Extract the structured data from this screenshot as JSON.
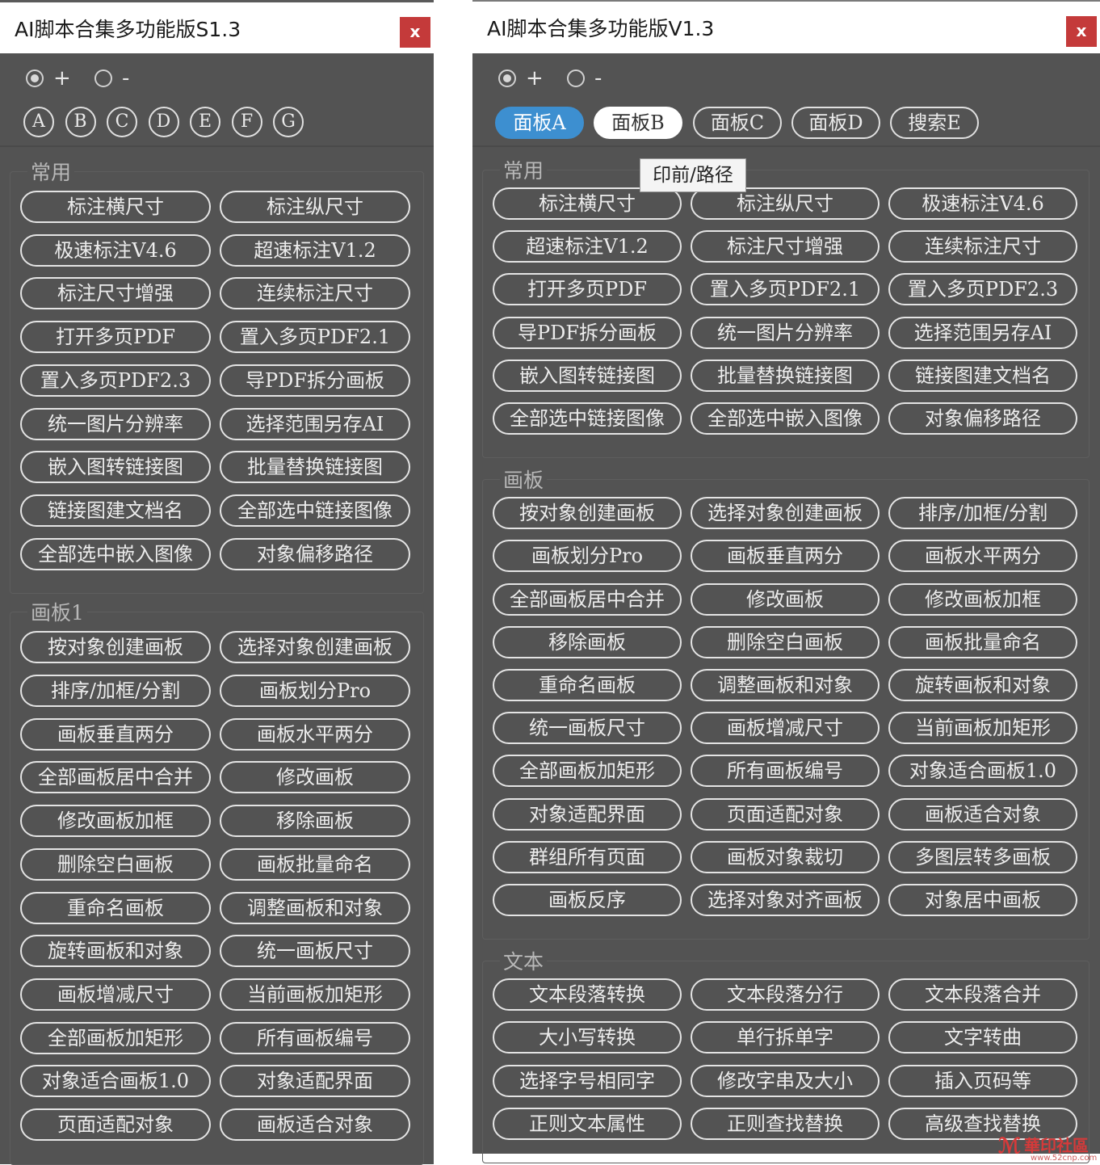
{
  "left_window": {
    "title": "AI脚本合集多功能版S1.3",
    "close_label": "x",
    "radio_plus": "+",
    "radio_minus": "-",
    "tabs": [
      "A",
      "B",
      "C",
      "D",
      "E",
      "F",
      "G"
    ],
    "groups": [
      {
        "label": "常用",
        "buttons": [
          "标注横尺寸",
          "标注纵尺寸",
          "极速标注V4.6",
          "超速标注V1.2",
          "标注尺寸增强",
          "连续标注尺寸",
          "打开多页PDF",
          "置入多页PDF2.1",
          "置入多页PDF2.3",
          "导PDF拆分画板",
          "统一图片分辨率",
          "选择范围另存AI",
          "嵌入图转链接图",
          "批量替换链接图",
          "链接图建文档名",
          "全部选中链接图像",
          "全部选中嵌入图像",
          "对象偏移路径"
        ]
      },
      {
        "label": "画板1",
        "buttons": [
          "按对象创建画板",
          "选择对象创建画板",
          "排序/加框/分割",
          "画板划分Pro",
          "画板垂直两分",
          "画板水平两分",
          "全部画板居中合并",
          "修改画板",
          "修改画板加框",
          "移除画板",
          "删除空白画板",
          "画板批量命名",
          "重命名画板",
          "调整画板和对象",
          "旋转画板和对象",
          "统一画板尺寸",
          "画板增减尺寸",
          "当前画板加矩形",
          "全部画板加矩形",
          "所有画板编号",
          "对象适合画板1.0",
          "对象适配界面",
          "页面适配对象",
          "画板适合对象"
        ]
      }
    ]
  },
  "right_window": {
    "title": "AI脚本合集多功能版V1.3",
    "close_label": "x",
    "radio_plus": "+",
    "radio_minus": "-",
    "tabs": [
      "面板A",
      "面板B",
      "面板C",
      "面板D",
      "搜索E"
    ],
    "tooltip": "印前/路径",
    "groups": [
      {
        "label": "常用",
        "buttons": [
          "标注横尺寸",
          "标注纵尺寸",
          "极速标注V4.6",
          "超速标注V1.2",
          "标注尺寸增强",
          "连续标注尺寸",
          "打开多页PDF",
          "置入多页PDF2.1",
          "置入多页PDF2.3",
          "导PDF拆分画板",
          "统一图片分辨率",
          "选择范围另存AI",
          "嵌入图转链接图",
          "批量替换链接图",
          "链接图建文档名",
          "全部选中链接图像",
          "全部选中嵌入图像",
          "对象偏移路径"
        ]
      },
      {
        "label": "画板",
        "buttons": [
          "按对象创建画板",
          "选择对象创建画板",
          "排序/加框/分割",
          "画板划分Pro",
          "画板垂直两分",
          "画板水平两分",
          "全部画板居中合并",
          "修改画板",
          "修改画板加框",
          "移除画板",
          "删除空白画板",
          "画板批量命名",
          "重命名画板",
          "调整画板和对象",
          "旋转画板和对象",
          "统一画板尺寸",
          "画板增减尺寸",
          "当前画板加矩形",
          "全部画板加矩形",
          "所有画板编号",
          "对象适合画板1.0",
          "对象适配界面",
          "页面适配对象",
          "画板适合对象",
          "群组所有页面",
          "画板对象裁切",
          "多图层转多画板",
          "画板反序",
          "选择对象对齐画板",
          "对象居中画板"
        ]
      },
      {
        "label": "文本",
        "buttons": [
          "文本段落转换",
          "文本段落分行",
          "文本段落合并",
          "大小写转换",
          "单行拆单字",
          "文字转曲",
          "选择字号相同字",
          "修改字串及大小",
          "插入页码等",
          "正则文本属性",
          "正则查找替换",
          "高级查找替换"
        ]
      }
    ]
  },
  "watermark": {
    "text": "華印社區",
    "url": "www.52cnp.com"
  }
}
